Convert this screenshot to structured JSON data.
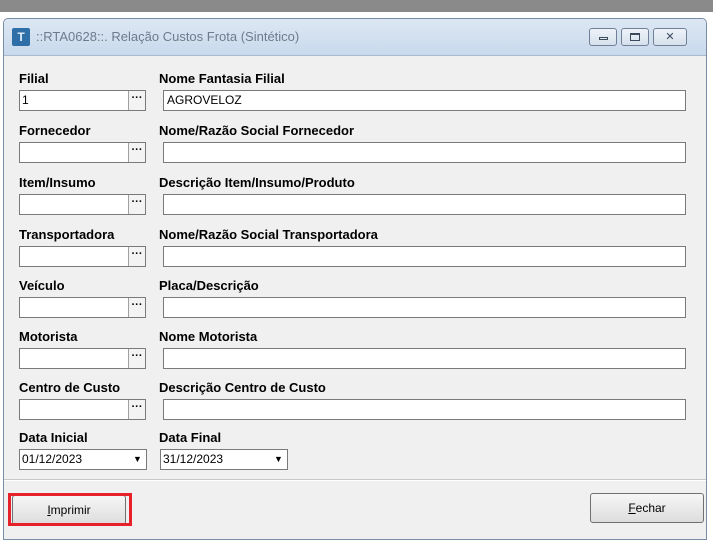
{
  "window": {
    "title": "::RTA0628::. Relação Custos Frota (Sintético)",
    "icon": "app-logo-icon"
  },
  "fields": [
    {
      "code_label": "Filial",
      "code_value": "1",
      "desc_label": "Nome Fantasia Filial",
      "desc_value": "AGROVELOZ"
    },
    {
      "code_label": "Fornecedor",
      "code_value": "",
      "desc_label": "Nome/Razão Social Fornecedor",
      "desc_value": ""
    },
    {
      "code_label": "Item/Insumo",
      "code_value": "",
      "desc_label": "Descrição Item/Insumo/Produto",
      "desc_value": ""
    },
    {
      "code_label": "Transportadora",
      "code_value": "",
      "desc_label": "Nome/Razão Social Transportadora",
      "desc_value": ""
    },
    {
      "code_label": "Veículo",
      "code_value": "",
      "desc_label": "Placa/Descrição",
      "desc_value": ""
    },
    {
      "code_label": "Motorista",
      "code_value": "",
      "desc_label": "Nome Motorista",
      "desc_value": ""
    },
    {
      "code_label": "Centro de Custo",
      "code_value": "",
      "desc_label": "Descrição Centro de Custo",
      "desc_value": ""
    }
  ],
  "lookup_button_glyph": "···",
  "dates": {
    "start_label": "Data Inicial",
    "start_value": "01/12/2023",
    "end_label": "Data Final",
    "end_value": "31/12/2023",
    "dropdown_glyph": "▼"
  },
  "buttons": {
    "print_label": "Imprimir",
    "print_accel": "I",
    "print_rest": "mprimir",
    "close_label": "Fechar",
    "close_accel": "F",
    "close_rest": "echar"
  },
  "colors": {
    "highlight": "#e8202a"
  }
}
